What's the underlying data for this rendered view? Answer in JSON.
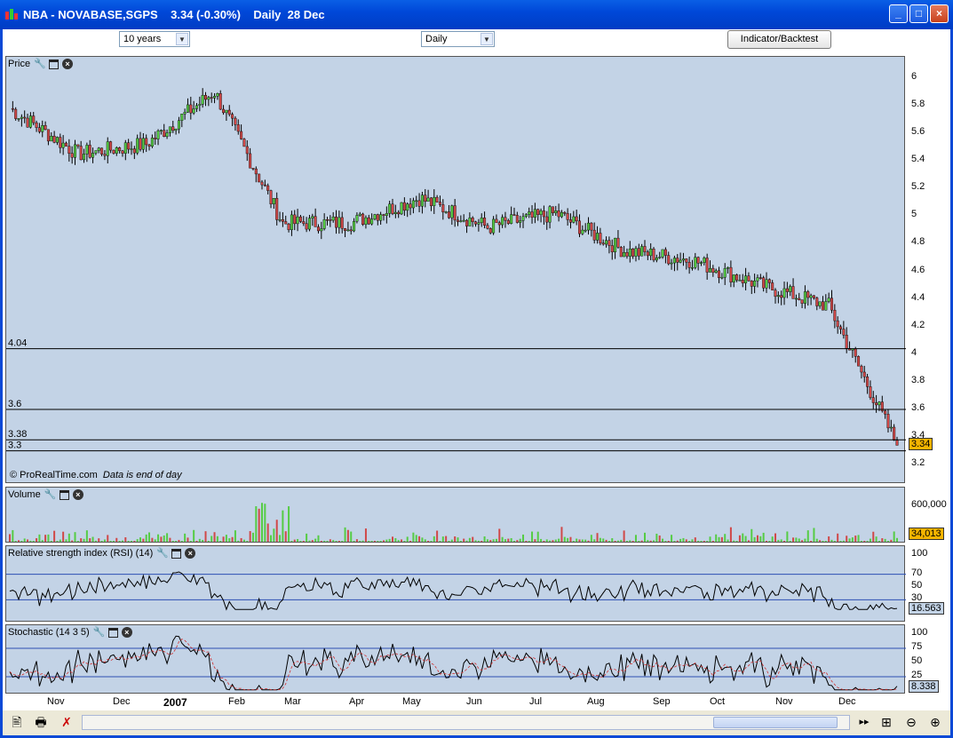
{
  "window": {
    "title": "NBA - NOVABASE,SGPS    3.34 (-0.30%)    Daily  28 Dec",
    "buttons": [
      "_",
      "□",
      "×"
    ]
  },
  "toolbar": {
    "period_select": "10 years",
    "interval_select": "Daily",
    "indicator_button": "Indicator/Backtest"
  },
  "price_panel": {
    "title": "Price",
    "credit": "© ProRealTime.com",
    "credit_note": "Data is end of day",
    "last_value": "3.34",
    "y_ticks": [
      "6",
      "5.8",
      "5.6",
      "5.4",
      "5.2",
      "5",
      "4.8",
      "4.6",
      "4.4",
      "4.2",
      "4",
      "3.8",
      "3.6",
      "3.4",
      "3.2"
    ],
    "hlines": [
      {
        "label": "4.04",
        "value": 4.04
      },
      {
        "label": "3.6",
        "value": 3.6
      },
      {
        "label": "3.38",
        "value": 3.38
      },
      {
        "label": "3.3",
        "value": 3.3
      }
    ]
  },
  "volume_panel": {
    "title": "Volume",
    "y_tick": "600,000",
    "last_value": "34,013"
  },
  "rsi_panel": {
    "title": "Relative strength index (RSI) (14)",
    "y_ticks": [
      "100",
      "70",
      "50",
      "30"
    ],
    "last_value": "16.563"
  },
  "stoch_panel": {
    "title": "Stochastic (14 3 5)",
    "y_ticks": [
      "100",
      "75",
      "50",
      "25"
    ],
    "last_value": "8.338"
  },
  "x_axis": [
    "Nov",
    "Dec",
    "2007",
    "Feb",
    "Mar",
    "Apr",
    "May",
    "Jun",
    "Jul",
    "Aug",
    "Sep",
    "Oct",
    "Nov",
    "Dec"
  ],
  "colors": {
    "up": "#55cc44",
    "down": "#d04848",
    "panel": "#c3d3e6",
    "last_tag": "#f5b400",
    "ref_line": "#2c4fb3",
    "signal": "#d03030"
  },
  "chart_data": {
    "type": "candlestick",
    "title": "NBA - NOVABASE,SGPS",
    "x": [
      "Nov",
      "Dec",
      "2007",
      "Feb",
      "Mar",
      "Apr",
      "May",
      "Jun",
      "Jul",
      "Aug",
      "Sep",
      "Oct",
      "Nov",
      "Dec"
    ],
    "close": [
      5.78,
      5.45,
      5.52,
      5.9,
      4.95,
      4.95,
      5.13,
      4.92,
      5.02,
      4.75,
      4.68,
      4.5,
      4.35,
      3.34
    ],
    "ylim": [
      3.15,
      6.05
    ],
    "reference_levels": [
      4.04,
      3.6,
      3.38,
      3.3
    ],
    "last": 3.34,
    "volume_last": 34013,
    "rsi_last": 16.563,
    "stochastic_last": 8.338
  }
}
